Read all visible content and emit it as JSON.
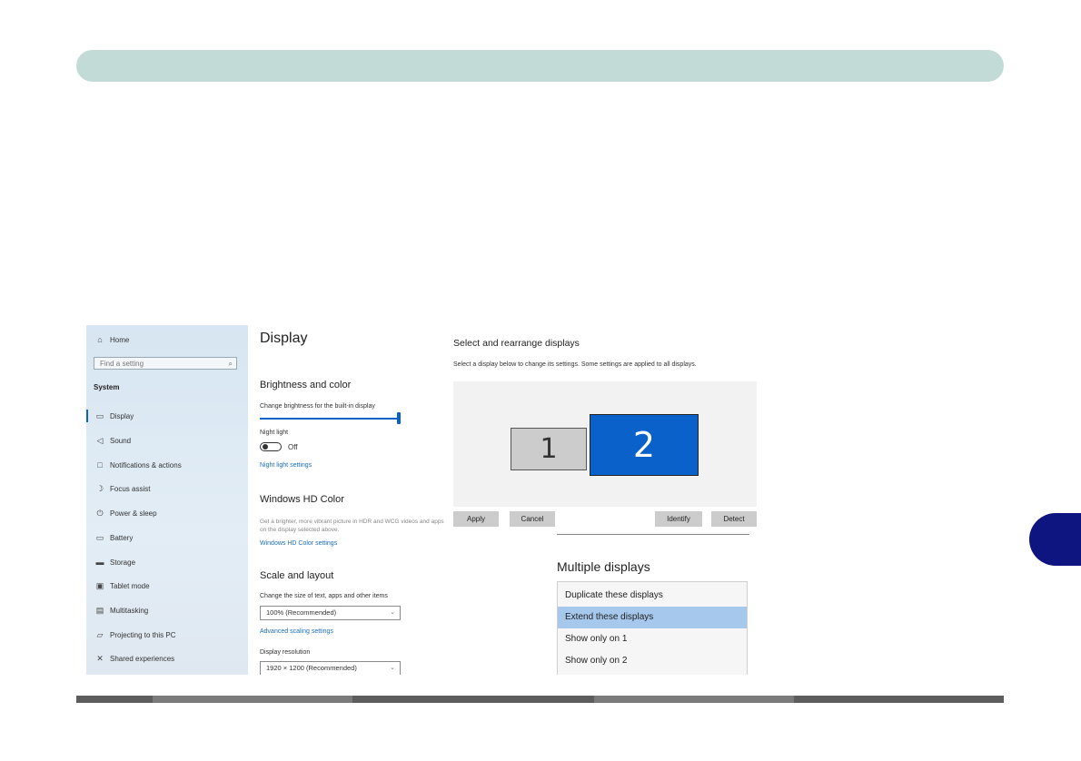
{
  "page": {
    "colors": {
      "band": "#c2dbd6",
      "tab": "#0f1580",
      "accent": "#0a61c9",
      "selected_option": "#a6c8ec"
    }
  },
  "sidebar": {
    "home_label": "Home",
    "home_icon": "home-icon",
    "search_placeholder": "Find a setting",
    "section_label": "System",
    "items": [
      {
        "label": "Display",
        "icon": "monitor-icon",
        "active": true
      },
      {
        "label": "Sound",
        "icon": "speaker-icon"
      },
      {
        "label": "Notifications & actions",
        "icon": "notification-icon"
      },
      {
        "label": "Focus assist",
        "icon": "moon-icon"
      },
      {
        "label": "Power & sleep",
        "icon": "power-icon"
      },
      {
        "label": "Battery",
        "icon": "battery-icon"
      },
      {
        "label": "Storage",
        "icon": "storage-icon"
      },
      {
        "label": "Tablet mode",
        "icon": "tablet-icon"
      },
      {
        "label": "Multitasking",
        "icon": "multitasking-icon"
      },
      {
        "label": "Projecting to this PC",
        "icon": "projector-icon"
      },
      {
        "label": "Shared experiences",
        "icon": "shared-icon"
      }
    ]
  },
  "main": {
    "title": "Display",
    "brightness": {
      "heading": "Brightness and color",
      "slider_label": "Change brightness for the built-in display",
      "slider_value_fraction": 1.0,
      "night_light_label": "Night light",
      "night_light_state": "Off",
      "night_light_link": "Night light settings"
    },
    "hdr": {
      "heading": "Windows HD Color",
      "description": "Get a brighter, more vibrant picture in HDR and WCG videos and apps on the display selected above.",
      "link": "Windows HD Color settings"
    },
    "scale": {
      "heading": "Scale and layout",
      "size_label": "Change the size of text, apps and other items",
      "size_value": "100% (Recommended)",
      "advanced_link": "Advanced scaling settings",
      "resolution_label": "Display resolution",
      "resolution_value": "1920 × 1200 (Recommended)"
    }
  },
  "arrange": {
    "title": "Select and rearrange displays",
    "subtitle": "Select a display below to change its settings. Some settings are applied to all displays.",
    "monitor_1": "1",
    "monitor_2": "2",
    "buttons": {
      "apply": "Apply",
      "cancel": "Cancel",
      "identify": "Identify",
      "detect": "Detect"
    }
  },
  "multiple_displays": {
    "title": "Multiple displays",
    "options": [
      {
        "label": "Duplicate these displays"
      },
      {
        "label": "Extend these displays",
        "selected": true
      },
      {
        "label": "Show only on 1"
      },
      {
        "label": "Show only on 2"
      }
    ]
  }
}
